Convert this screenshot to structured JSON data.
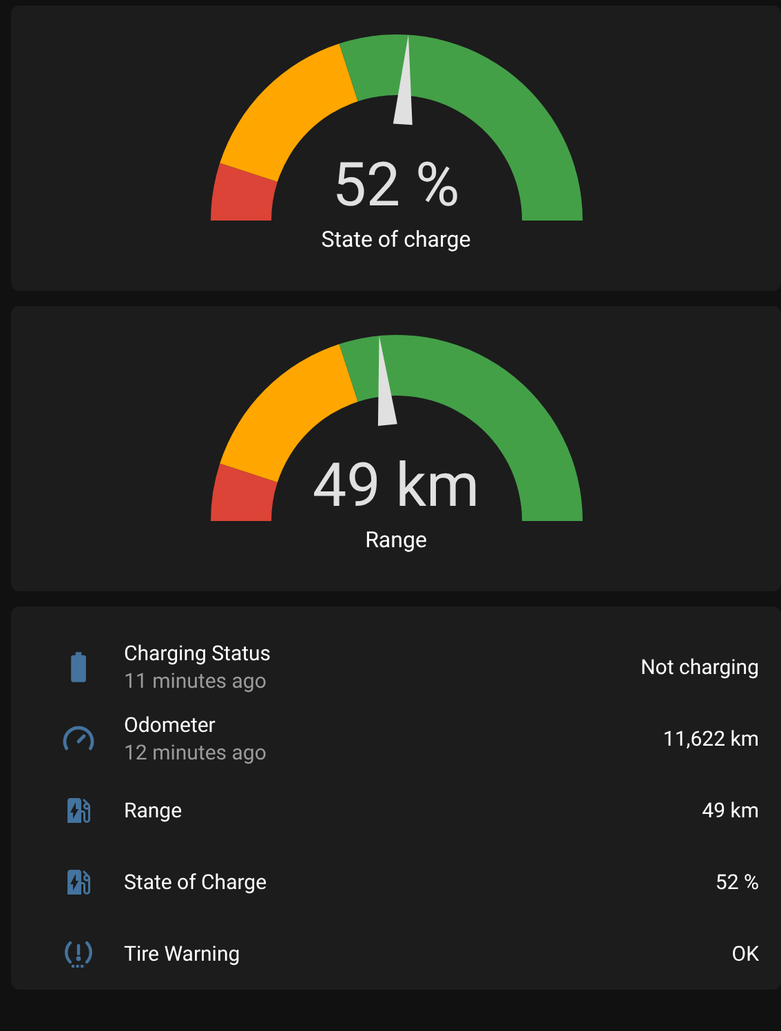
{
  "gauges": [
    {
      "value": "52 %",
      "name": "State of charge"
    },
    {
      "value": "49 km",
      "name": "Range"
    }
  ],
  "entities": [
    {
      "kind": "battery",
      "name": "Charging Status",
      "time": "11 minutes ago",
      "value": "Not charging"
    },
    {
      "kind": "odometer",
      "name": "Odometer",
      "time": "12 minutes ago",
      "value": "11,622 km"
    },
    {
      "kind": "ev-station",
      "name": "Range",
      "value": "49 km"
    },
    {
      "kind": "ev-station",
      "name": "State of Charge",
      "value": "52 %"
    },
    {
      "kind": "tire",
      "name": "Tire Warning",
      "value": "OK"
    }
  ]
}
